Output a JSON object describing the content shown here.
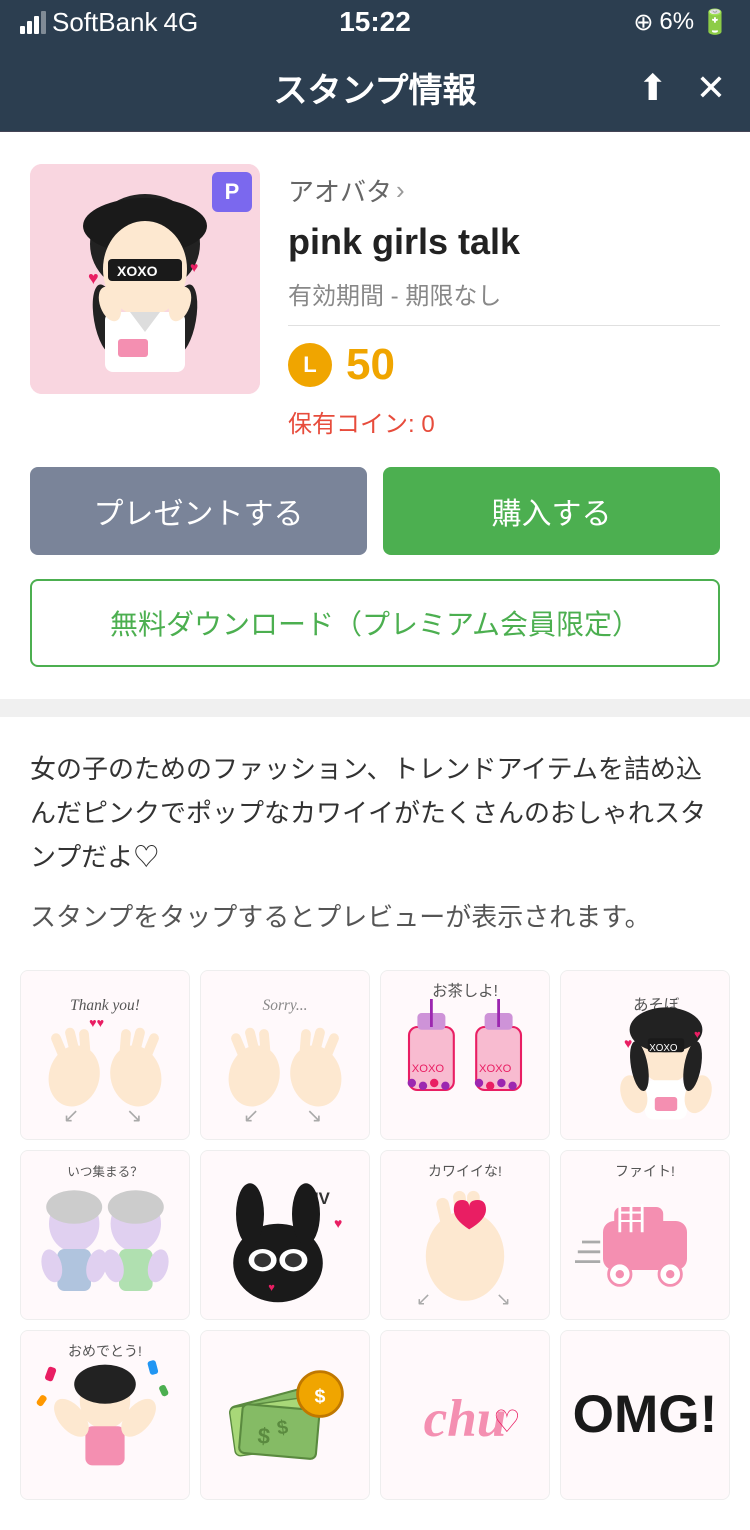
{
  "statusBar": {
    "carrier": "SoftBank",
    "network": "4G",
    "time": "15:22",
    "battery": "6%"
  },
  "navBar": {
    "title": "スタンプ情報",
    "shareIcon": "⬆",
    "closeIcon": "✕"
  },
  "product": {
    "author": "アオバタ",
    "authorArrow": "›",
    "name": "pink girls talk",
    "validity": "有効期間 - 期限なし",
    "badgeLabel": "P",
    "coinIconLabel": "L",
    "price": "50",
    "balance": "保有コイン: 0"
  },
  "buttons": {
    "present": "プレゼントする",
    "buy": "購入する",
    "freeDownload": "無料ダウンロード（プレミアム会員限定）"
  },
  "description": {
    "text": "女の子のためのファッション、トレンドアイテムを詰め込んだピンクでポップなカワイイがたくさんのおしゃれスタンプだよ♡",
    "previewHint": "スタンプをタップするとプレビューが表示されます。"
  },
  "stickers": [
    {
      "id": 1,
      "label": "Thank you!",
      "type": "thankyou"
    },
    {
      "id": 2,
      "label": "Sorry...",
      "type": "sorry"
    },
    {
      "id": 3,
      "label": "お茶しよ!",
      "type": "tea"
    },
    {
      "id": 4,
      "label": "あそぼ",
      "type": "girl1"
    },
    {
      "id": 5,
      "label": "いつ集まる？",
      "type": "girls2"
    },
    {
      "id": 6,
      "label": "LUV",
      "type": "bunny"
    },
    {
      "id": 7,
      "label": "カワイイな!",
      "type": "heart"
    },
    {
      "id": 8,
      "label": "ファイト!",
      "type": "skates"
    },
    {
      "id": 9,
      "label": "おめでとう!",
      "type": "celebrate"
    },
    {
      "id": 10,
      "label": "money",
      "type": "money"
    },
    {
      "id": 11,
      "label": "chu♡",
      "type": "chu"
    },
    {
      "id": 12,
      "label": "OMG!",
      "type": "omg"
    }
  ]
}
